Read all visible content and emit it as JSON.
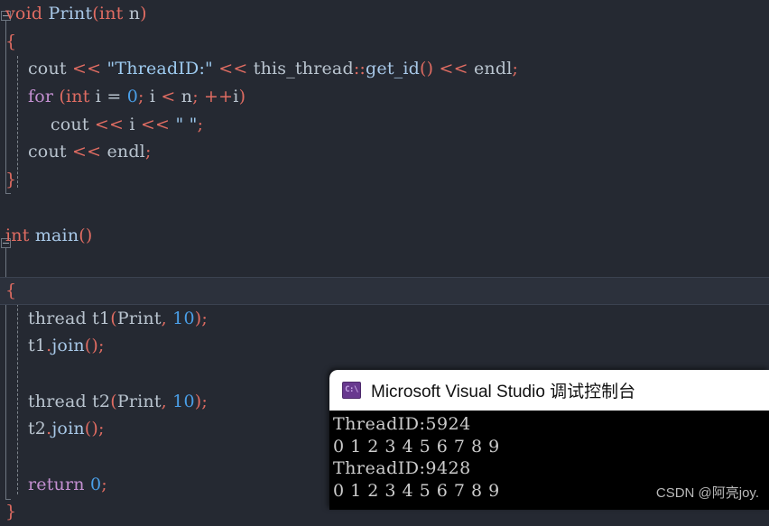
{
  "editor": {
    "theme_background": "#252932",
    "current_line_index": 10,
    "lines": [
      {
        "indent": 0,
        "tokens": [
          {
            "t": "void",
            "c": "kw"
          },
          {
            "t": " ",
            "c": "op"
          },
          {
            "t": "Print",
            "c": "fn"
          },
          {
            "t": "(",
            "c": "punc"
          },
          {
            "t": "int",
            "c": "kw"
          },
          {
            "t": " n",
            "c": "id"
          },
          {
            "t": ")",
            "c": "punc"
          }
        ]
      },
      {
        "indent": 0,
        "tokens": [
          {
            "t": "{",
            "c": "brace"
          }
        ]
      },
      {
        "indent": 0,
        "tokens": [
          {
            "t": "    cout ",
            "c": "id"
          },
          {
            "t": "<<",
            "c": "punc"
          },
          {
            "t": " ",
            "c": "op"
          },
          {
            "t": "\"ThreadID:\"",
            "c": "str"
          },
          {
            "t": " ",
            "c": "op"
          },
          {
            "t": "<<",
            "c": "punc"
          },
          {
            "t": " this_thread",
            "c": "id"
          },
          {
            "t": "::",
            "c": "punc"
          },
          {
            "t": "get_id",
            "c": "fn"
          },
          {
            "t": "()",
            "c": "punc"
          },
          {
            "t": " ",
            "c": "op"
          },
          {
            "t": "<<",
            "c": "punc"
          },
          {
            "t": " endl",
            "c": "id"
          },
          {
            "t": ";",
            "c": "punc"
          }
        ]
      },
      {
        "indent": 0,
        "tokens": [
          {
            "t": "    ",
            "c": "op"
          },
          {
            "t": "for",
            "c": "kwctl"
          },
          {
            "t": " ",
            "c": "op"
          },
          {
            "t": "(",
            "c": "punc"
          },
          {
            "t": "int",
            "c": "kw"
          },
          {
            "t": " i ",
            "c": "id"
          },
          {
            "t": "=",
            "c": "op"
          },
          {
            "t": " ",
            "c": "op"
          },
          {
            "t": "0",
            "c": "num"
          },
          {
            "t": ";",
            "c": "punc"
          },
          {
            "t": " i ",
            "c": "id"
          },
          {
            "t": "<",
            "c": "punc"
          },
          {
            "t": " n",
            "c": "id"
          },
          {
            "t": ";",
            "c": "punc"
          },
          {
            "t": " ",
            "c": "op"
          },
          {
            "t": "++",
            "c": "punc"
          },
          {
            "t": "i",
            "c": "id"
          },
          {
            "t": ")",
            "c": "punc"
          }
        ]
      },
      {
        "indent": 0,
        "tokens": [
          {
            "t": "        cout ",
            "c": "id"
          },
          {
            "t": "<<",
            "c": "punc"
          },
          {
            "t": " i ",
            "c": "id"
          },
          {
            "t": "<<",
            "c": "punc"
          },
          {
            "t": " ",
            "c": "op"
          },
          {
            "t": "\" \"",
            "c": "str"
          },
          {
            "t": ";",
            "c": "punc"
          }
        ]
      },
      {
        "indent": 0,
        "tokens": [
          {
            "t": "    cout ",
            "c": "id"
          },
          {
            "t": "<<",
            "c": "punc"
          },
          {
            "t": " endl",
            "c": "id"
          },
          {
            "t": ";",
            "c": "punc"
          }
        ]
      },
      {
        "indent": 0,
        "tokens": [
          {
            "t": "}",
            "c": "brace"
          }
        ]
      },
      {
        "indent": 0,
        "tokens": []
      },
      {
        "indent": 0,
        "tokens": [
          {
            "t": "int",
            "c": "kw"
          },
          {
            "t": " ",
            "c": "op"
          },
          {
            "t": "main",
            "c": "fn"
          },
          {
            "t": "()",
            "c": "punc"
          }
        ]
      },
      {
        "indent": 0,
        "tokens": []
      },
      {
        "indent": 0,
        "tokens": [
          {
            "t": "{",
            "c": "brace"
          }
        ]
      },
      {
        "indent": 0,
        "tokens": [
          {
            "t": "    thread t1",
            "c": "id"
          },
          {
            "t": "(",
            "c": "punc"
          },
          {
            "t": "Print",
            "c": "id"
          },
          {
            "t": ",",
            "c": "punc"
          },
          {
            "t": " ",
            "c": "op"
          },
          {
            "t": "10",
            "c": "num"
          },
          {
            "t": ")",
            "c": "punc"
          },
          {
            "t": ";",
            "c": "punc"
          }
        ]
      },
      {
        "indent": 0,
        "tokens": [
          {
            "t": "    t1",
            "c": "id"
          },
          {
            "t": ".",
            "c": "punc"
          },
          {
            "t": "join",
            "c": "fn"
          },
          {
            "t": "()",
            "c": "punc"
          },
          {
            "t": ";",
            "c": "punc"
          }
        ]
      },
      {
        "indent": 0,
        "tokens": []
      },
      {
        "indent": 0,
        "tokens": [
          {
            "t": "    thread t2",
            "c": "id"
          },
          {
            "t": "(",
            "c": "punc"
          },
          {
            "t": "Print",
            "c": "id"
          },
          {
            "t": ",",
            "c": "punc"
          },
          {
            "t": " ",
            "c": "op"
          },
          {
            "t": "10",
            "c": "num"
          },
          {
            "t": ")",
            "c": "punc"
          },
          {
            "t": ";",
            "c": "punc"
          }
        ]
      },
      {
        "indent": 0,
        "tokens": [
          {
            "t": "    t2",
            "c": "id"
          },
          {
            "t": ".",
            "c": "punc"
          },
          {
            "t": "join",
            "c": "fn"
          },
          {
            "t": "()",
            "c": "punc"
          },
          {
            "t": ";",
            "c": "punc"
          }
        ]
      },
      {
        "indent": 0,
        "tokens": []
      },
      {
        "indent": 0,
        "tokens": [
          {
            "t": "    ",
            "c": "op"
          },
          {
            "t": "return",
            "c": "kwctl"
          },
          {
            "t": " ",
            "c": "op"
          },
          {
            "t": "0",
            "c": "num"
          },
          {
            "t": ";",
            "c": "punc"
          }
        ]
      },
      {
        "indent": 0,
        "tokens": [
          {
            "t": "}",
            "c": "brace"
          }
        ]
      }
    ],
    "fold_markers": [
      {
        "line": 0,
        "state": "expanded",
        "icon": "minus-box-icon"
      },
      {
        "line": 8,
        "state": "expanded",
        "icon": "minus-box-icon"
      }
    ]
  },
  "console": {
    "icon": "console-cmd-icon",
    "icon_label": "C:\\",
    "title": "Microsoft Visual Studio 调试控制台",
    "output_lines": [
      "ThreadID:5924",
      "0 1 2 3 4 5 6 7 8 9",
      "ThreadID:9428",
      "0 1 2 3 4 5 6 7 8 9"
    ]
  },
  "watermark": {
    "text": "CSDN @阿亮joy."
  }
}
